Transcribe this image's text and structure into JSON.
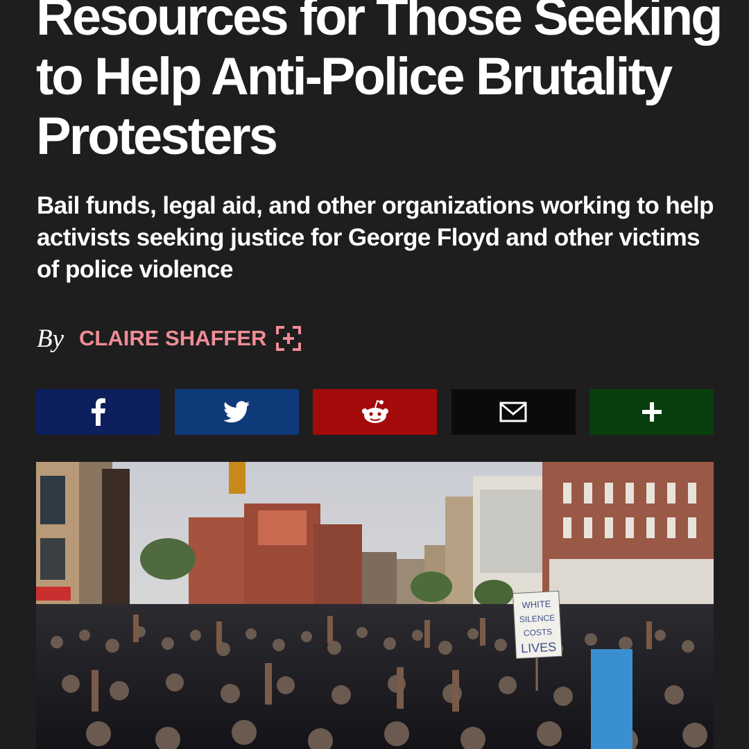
{
  "article": {
    "headline": "Resources for Those Seeking to Help Anti-Police Brutality Protesters",
    "dek": "Bail funds, legal aid, and other organizations working to help activists seeking justice for George Floyd and other victims of police violence",
    "byline": {
      "by_label": "By",
      "author": "CLAIRE SHAFFER",
      "follow_icon": "follow-author-icon"
    }
  },
  "share_bar": {
    "buttons": [
      {
        "name": "facebook",
        "icon": "facebook-icon",
        "color": "#0d1f5c"
      },
      {
        "name": "twitter",
        "icon": "twitter-icon",
        "color": "#0f3a7a"
      },
      {
        "name": "reddit",
        "icon": "reddit-icon",
        "color": "#a30b0b"
      },
      {
        "name": "email",
        "icon": "mail-icon",
        "color": "#0b0b0b"
      },
      {
        "name": "more",
        "icon": "plus-icon",
        "color": "#083d0d"
      }
    ]
  },
  "hero_image": {
    "sign_text": [
      "WHITE",
      "SILENCE",
      "COSTS",
      "LIVES"
    ]
  },
  "colors": {
    "background": "#1e1e1e",
    "author": "#f08c96",
    "text": "#ffffff"
  }
}
